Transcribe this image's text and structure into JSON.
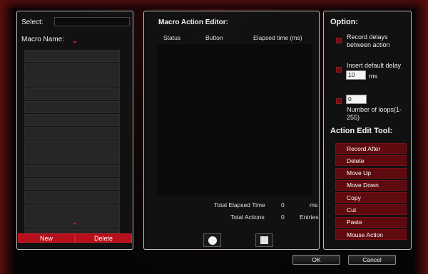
{
  "left": {
    "select_label": "Select:",
    "select_value": "",
    "macro_name_label": "Macro Name:",
    "rows": 15,
    "new_label": "New",
    "delete_label": "Delete"
  },
  "editor": {
    "title": "Macro Action Editor:",
    "columns": [
      "Status",
      "Button",
      "Elapsed time (ms)"
    ],
    "total_elapsed_label": "Total Elapsed Time",
    "total_elapsed_value": "0",
    "total_elapsed_unit": "ms",
    "total_actions_label": "Total Actions",
    "total_actions_value": "0",
    "total_actions_unit": "Entries"
  },
  "options": {
    "title": "Option:",
    "record_delays": "Record delays between action",
    "insert_delay": "Insert default delay",
    "delay_value": "10",
    "delay_unit": "ms",
    "loops_value": "0",
    "loops_label": "Number of loops(1-255)"
  },
  "tools": {
    "title": "Action Edit Tool:",
    "items": [
      "Record After",
      "Delete",
      "Move Up",
      "Move Down",
      "Copy",
      "Cut",
      "Paste",
      "Mouse Action"
    ]
  },
  "footer": {
    "ok_label": "OK",
    "cancel_label": "Cancel"
  },
  "colors": {
    "accent_red": "#b8101a",
    "tool_red": "#5e0a0e",
    "panel_bg": "#121212"
  }
}
